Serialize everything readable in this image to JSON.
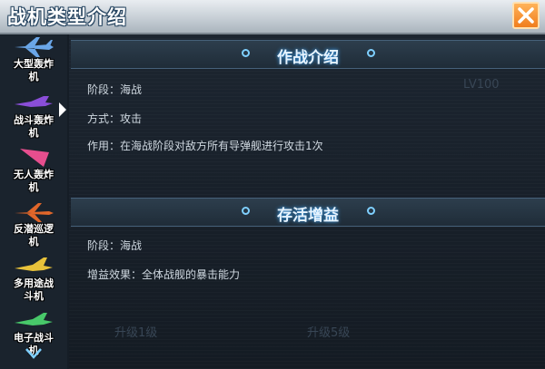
{
  "window": {
    "title": "战机类型介绍"
  },
  "sidebar": {
    "items": [
      {
        "label_l1": "大型轰炸",
        "label_l2": "机",
        "icon": "bomber-plane-icon",
        "color": "#6aa6e8"
      },
      {
        "label_l1": "战斗轰炸",
        "label_l2": "机",
        "icon": "fighter-bomber-icon",
        "color": "#8a4ed8"
      },
      {
        "label_l1": "无人轰炸",
        "label_l2": "机",
        "icon": "drone-bomber-icon",
        "color": "#e64e8e"
      },
      {
        "label_l1": "反潜巡逻",
        "label_l2": "机",
        "icon": "asw-patrol-icon",
        "color": "#e0662a"
      },
      {
        "label_l1": "多用途战",
        "label_l2": "斗机",
        "icon": "multirole-fighter-icon",
        "color": "#e8c23a"
      },
      {
        "label_l1": "电子战斗",
        "label_l2": "机",
        "icon": "ew-fighter-icon",
        "color": "#48c86a"
      }
    ],
    "selected_index": 1
  },
  "combat_section": {
    "header": "作战介绍",
    "rows": [
      {
        "key": "阶段：",
        "value": "海战"
      },
      {
        "key": "方式：",
        "value": "攻击"
      },
      {
        "key": "作用：",
        "value": "在海战阶段对敌方所有导弹舰进行攻击1次"
      }
    ]
  },
  "survival_section": {
    "header": "存活增益",
    "rows": [
      {
        "key": "阶段：",
        "value": "海战"
      },
      {
        "key": "增益效果：",
        "value": "全体战舰的暴击能力"
      }
    ]
  },
  "background_ghost": {
    "level": "LV100",
    "upgrade1": "升级1级",
    "upgrade5": "升级5级"
  }
}
